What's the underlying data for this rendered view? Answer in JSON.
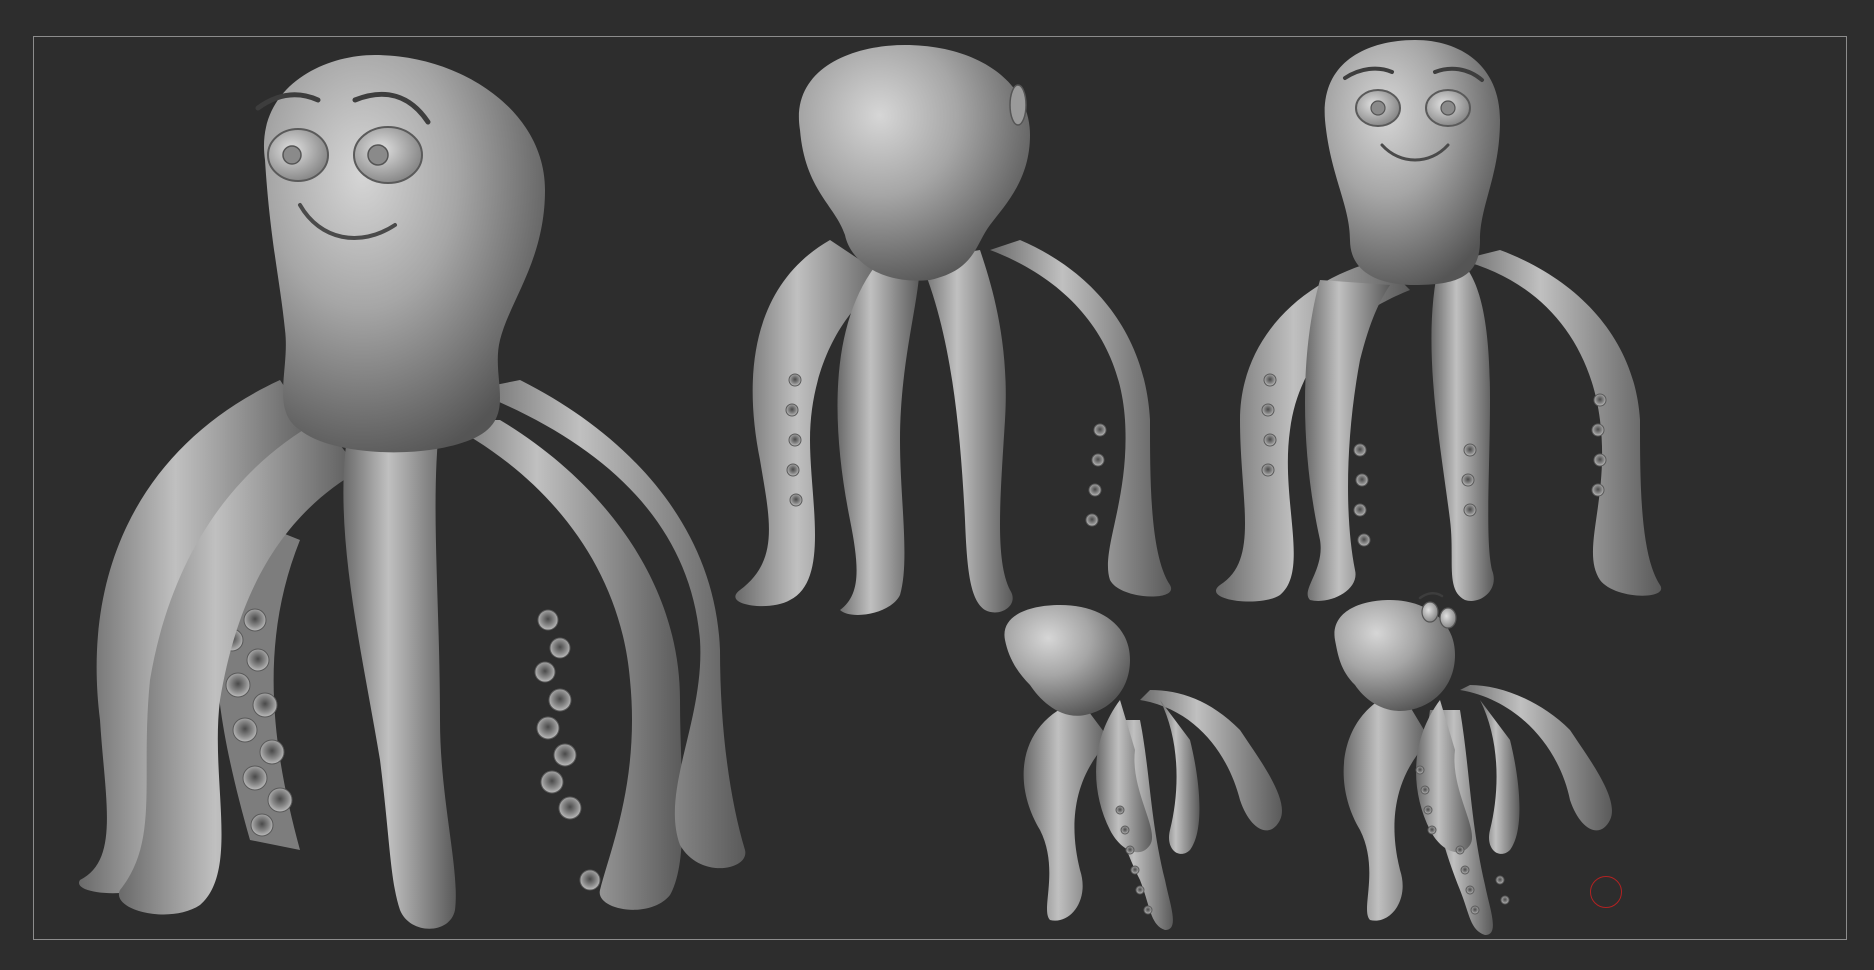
{
  "viewport": {
    "background_color": "#2d2d2d",
    "frame_color": "#8c8c8c",
    "material_color": "#9a9a9a",
    "models": [
      {
        "name": "octopus-front-three-quarter-large"
      },
      {
        "name": "octopus-back"
      },
      {
        "name": "octopus-front"
      },
      {
        "name": "octopus-top-back-small"
      },
      {
        "name": "octopus-top-front-small"
      }
    ],
    "cursor": {
      "icon": "brush-circle-icon",
      "color": "#b22222"
    }
  }
}
